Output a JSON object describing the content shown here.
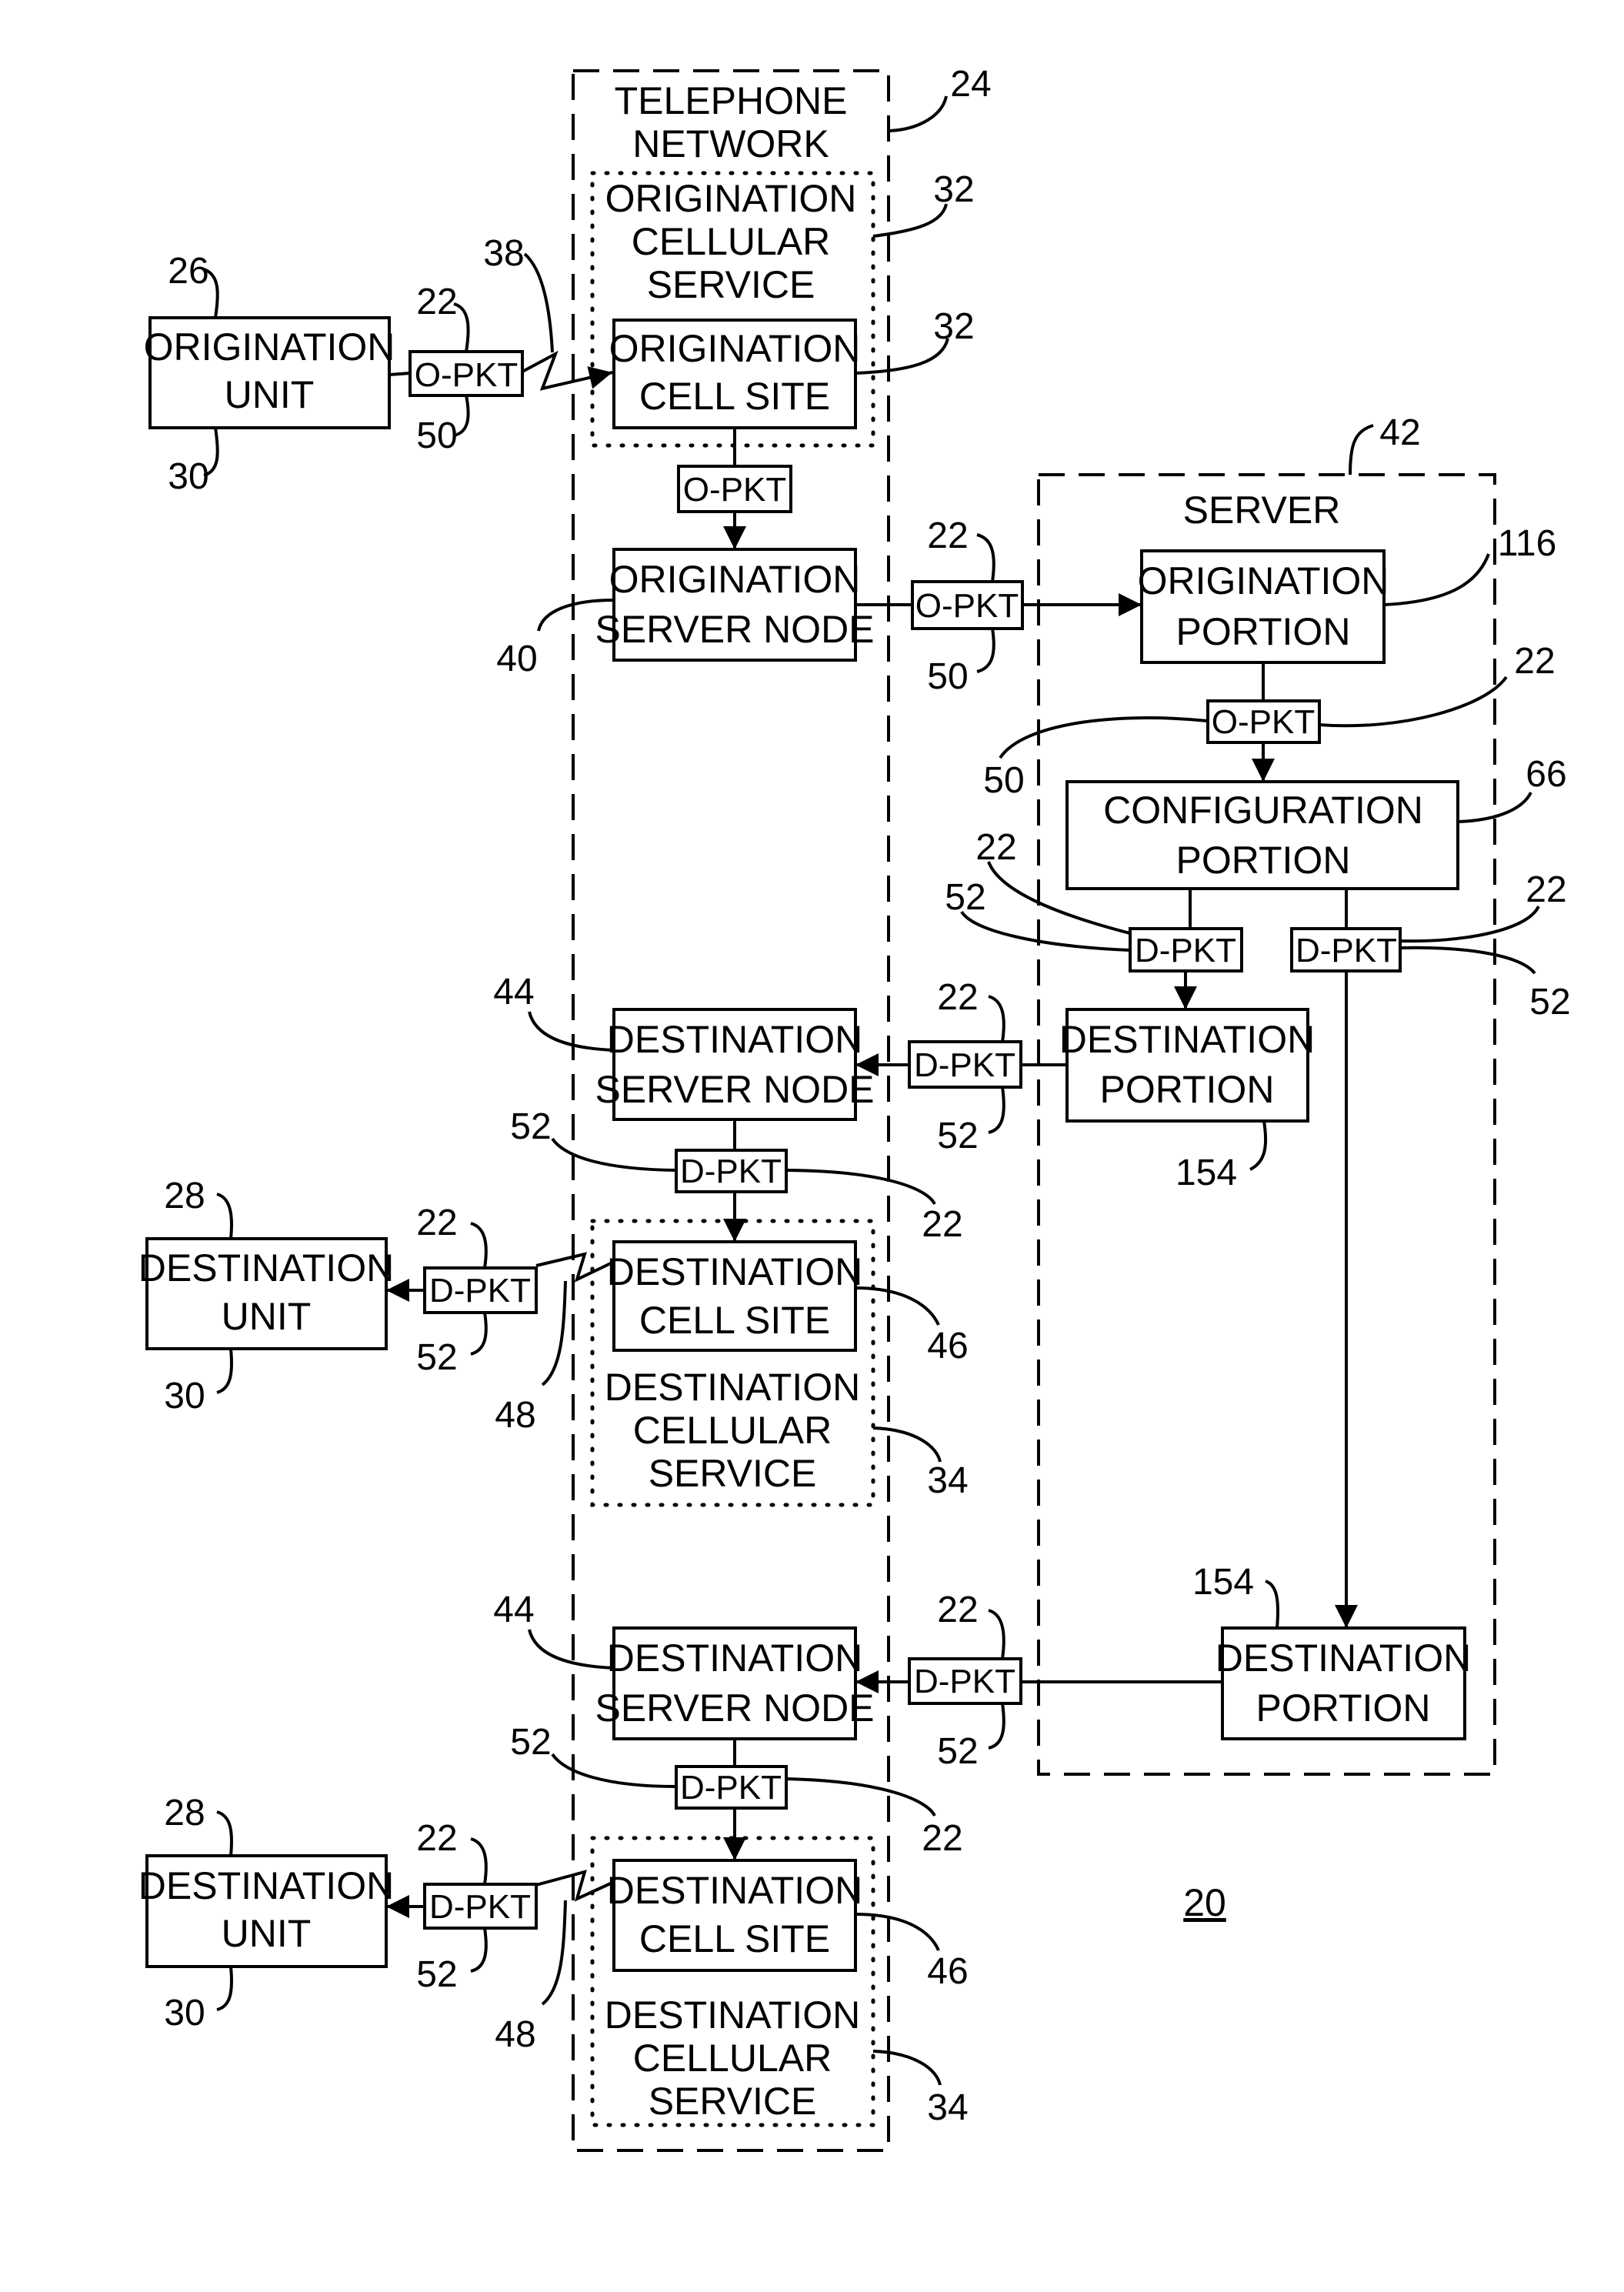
{
  "figure_number": "20",
  "telephone_network": {
    "label_lines": [
      "TELEPHONE",
      "NETWORK"
    ],
    "ref": "24"
  },
  "server": {
    "label": "SERVER",
    "ref": "42"
  },
  "origination_cellular_service": {
    "label_lines": [
      "ORIGINATION",
      "CELLULAR",
      "SERVICE"
    ],
    "ref": "32"
  },
  "origination_unit": {
    "label_lines": [
      "ORIGINATION",
      "UNIT"
    ],
    "ref_top": "26",
    "ref_bottom": "30"
  },
  "origination_cell_site": {
    "label_lines": [
      "ORIGINATION",
      "CELL SITE"
    ],
    "ref": "32"
  },
  "origination_server_node": {
    "label_lines": [
      "ORIGINATION",
      "SERVER NODE"
    ],
    "ref": "40"
  },
  "origination_portion": {
    "label_lines": [
      "ORIGINATION",
      "PORTION"
    ],
    "ref": "116"
  },
  "configuration_portion": {
    "label_lines": [
      "CONFIGURATION",
      "PORTION"
    ],
    "ref": "66"
  },
  "destination_portion_1": {
    "label_lines": [
      "DESTINATION",
      "PORTION"
    ],
    "ref": "154"
  },
  "destination_portion_2": {
    "label_lines": [
      "DESTINATION",
      "PORTION"
    ],
    "ref": "154"
  },
  "destination_server_node_1": {
    "label_lines": [
      "DESTINATION",
      "SERVER NODE"
    ],
    "ref": "44"
  },
  "destination_server_node_2": {
    "label_lines": [
      "DESTINATION",
      "SERVER NODE"
    ],
    "ref": "44"
  },
  "destination_cell_site_1": {
    "label_lines": [
      "DESTINATION",
      "CELL SITE"
    ],
    "ref": "46"
  },
  "destination_cell_site_2": {
    "label_lines": [
      "DESTINATION",
      "CELL SITE"
    ],
    "ref": "46"
  },
  "destination_cellular_service_1": {
    "label_lines": [
      "DESTINATION",
      "CELLULAR",
      "SERVICE"
    ],
    "ref": "34"
  },
  "destination_cellular_service_2": {
    "label_lines": [
      "DESTINATION",
      "CELLULAR",
      "SERVICE"
    ],
    "ref": "34"
  },
  "destination_unit_1": {
    "label_lines": [
      "DESTINATION",
      "UNIT"
    ],
    "ref_top": "28",
    "ref_bottom": "30"
  },
  "destination_unit_2": {
    "label_lines": [
      "DESTINATION",
      "UNIT"
    ],
    "ref_top": "28",
    "ref_bottom": "30"
  },
  "wireless_links": {
    "origination_ref": "38",
    "destination_ref": "48"
  },
  "packets": {
    "o_pkt_label": "O-PKT",
    "d_pkt_label": "D-PKT",
    "packet_ref": "22",
    "o_pkt_ref": "50",
    "d_pkt_ref": "52"
  }
}
